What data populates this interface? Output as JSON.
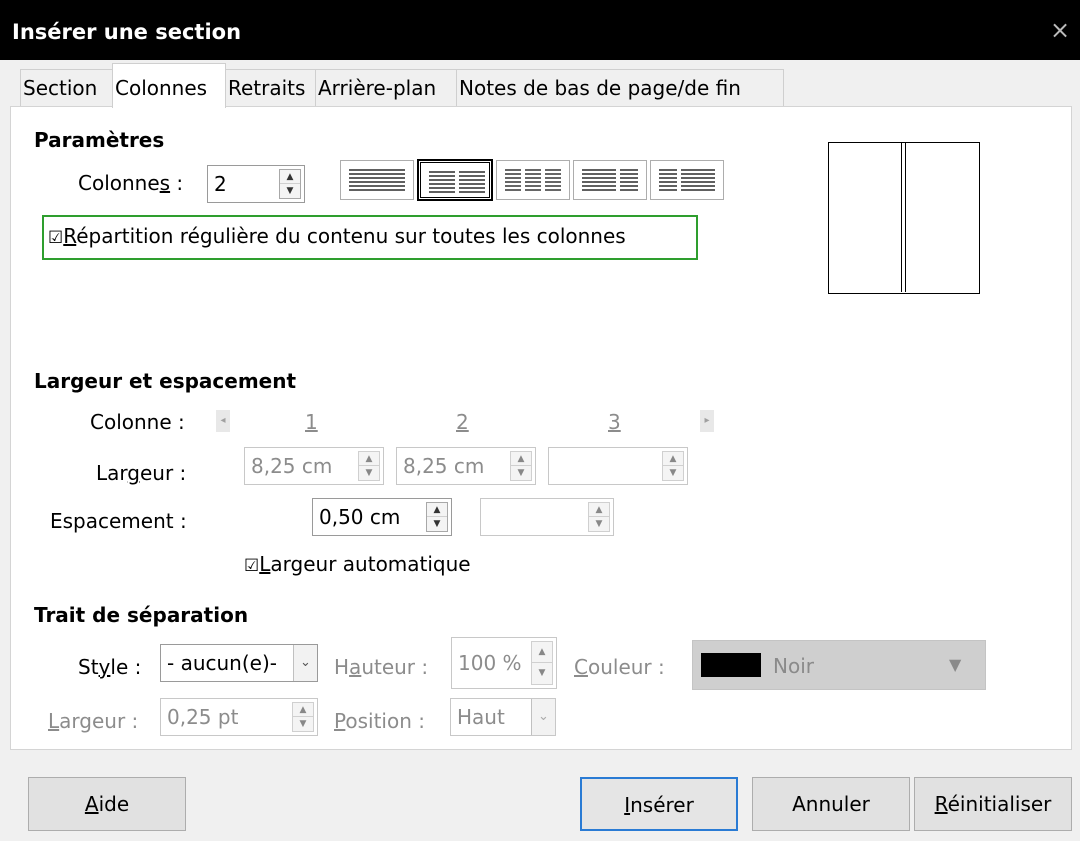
{
  "window": {
    "title": "Insérer une section",
    "close_glyph": "×"
  },
  "tabs": [
    {
      "label": "Section"
    },
    {
      "label": "Colonnes",
      "active": true
    },
    {
      "label": "Retraits"
    },
    {
      "label": "Arrière-plan"
    },
    {
      "label": "Notes de bas de page/de fin"
    }
  ],
  "parametres": {
    "heading": "Paramètres",
    "colonnes_label_pre": "Colonne",
    "colonnes_label_u": "s",
    "colonnes_label_post": " :",
    "colonnes_value": "2",
    "layouts": [
      "1 colonne",
      "2 colonnes",
      "3 colonnes",
      "2 colonnes (gauche large)",
      "2 colonnes (droite large)"
    ],
    "selected_layout": "2 colonnes",
    "even_distribution": {
      "checked": true,
      "mnemonic": "R",
      "rest": "épartition régulière du contenu sur toutes les colonnes"
    }
  },
  "largeur": {
    "heading": "Largeur et espacement",
    "colonne_label": "Colonne :",
    "col_numbers": [
      "1",
      "2",
      "3"
    ],
    "largeur_label_pre": "Lar",
    "largeur_label_u": "g",
    "largeur_label_post": "eur :",
    "widths": [
      "8,25 cm",
      "8,25 cm",
      ""
    ],
    "espacement_label": "Espacement :",
    "spacing": [
      "0,50 cm",
      ""
    ],
    "auto_width": {
      "checked": true,
      "mnemonic": "L",
      "rest": "argeur automatique"
    }
  },
  "separateur": {
    "heading": "Trait de séparation",
    "style_label_pre": "St",
    "style_label_u": "y",
    "style_label_post": "le :",
    "style_value": "- aucun(e)-",
    "hauteur_label_pre": "H",
    "hauteur_label_u": "a",
    "hauteur_label_post": "uteur :",
    "hauteur_value": "100 %",
    "couleur_label_u": "C",
    "couleur_label_post": "ouleur :",
    "couleur_value": "Noir",
    "couleur_hex": "#000000",
    "largeur_label_u": "L",
    "largeur_label_post": "argeur :",
    "largeur_value": "0,25 pt",
    "position_label_u": "P",
    "position_label_post": "osition :",
    "position_value": "Haut"
  },
  "buttons": {
    "aide_u": "A",
    "aide_rest": "ide",
    "inserer_u": "I",
    "inserer_rest": "nsérer",
    "annuler": "Annuler",
    "reinit_u": "R",
    "reinit_rest": "éinitialiser"
  },
  "colors": {
    "accent_focus": "#2e9e2e",
    "default_button": "#2a7bd4"
  }
}
